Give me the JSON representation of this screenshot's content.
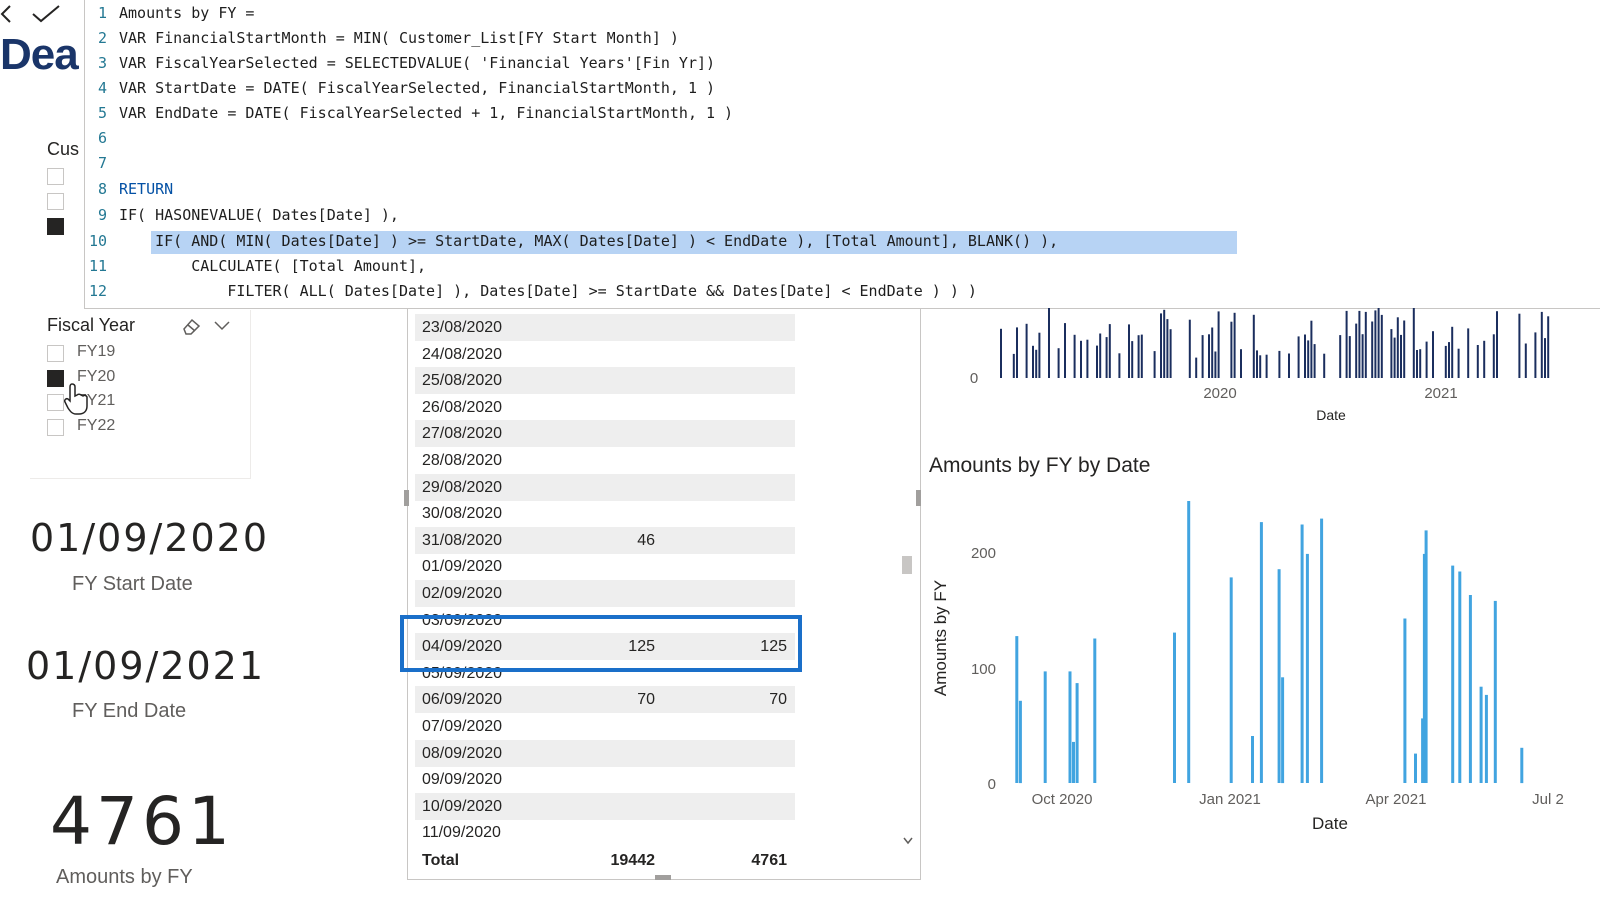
{
  "formula": {
    "lines": [
      {
        "n": "1",
        "text": "Amounts by FY ="
      },
      {
        "n": "2",
        "text": "VAR FinancialStartMonth = MIN( Customer_List[FY Start Month] )"
      },
      {
        "n": "3",
        "text": "VAR FiscalYearSelected = SELECTEDVALUE( 'Financial Years'[Fin Yr])"
      },
      {
        "n": "4",
        "text": "VAR StartDate = DATE( FiscalYearSelected, FinancialStartMonth, 1 )"
      },
      {
        "n": "5",
        "text": "VAR EndDate = DATE( FiscalYearSelected + 1, FinancialStartMonth, 1 )"
      },
      {
        "n": "6",
        "text": ""
      },
      {
        "n": "7",
        "text": ""
      },
      {
        "n": "8",
        "text": "RETURN"
      },
      {
        "n": "9",
        "text": "IF( HASONEVALUE( Dates[Date] ),"
      },
      {
        "n": "10",
        "text": "    IF( AND( MIN( Dates[Date] ) >= StartDate, MAX( Dates[Date] ) < EndDate ), [Total Amount], BLANK() ),"
      },
      {
        "n": "11",
        "text": "        CALCULATE( [Total Amount],"
      },
      {
        "n": "12",
        "text": "            FILTER( ALL( Dates[Date] ), Dates[Date] >= StartDate && Dates[Date] < EndDate ) ) )"
      }
    ]
  },
  "report": {
    "title_fragment": "Dea",
    "customer_slicer_title": "Cus"
  },
  "fy_slicer": {
    "title": "Fiscal Year",
    "items": [
      {
        "label": "FY19",
        "checked": false
      },
      {
        "label": "FY20",
        "checked": true
      },
      {
        "label": "FY21",
        "checked": false
      },
      {
        "label": "FY22",
        "checked": false
      }
    ]
  },
  "cards": {
    "start": {
      "value": "01/09/2020",
      "label": "FY Start Date"
    },
    "end": {
      "value": "01/09/2021",
      "label": "FY End Date"
    },
    "amount": {
      "value": "4761",
      "label": "Amounts by FY"
    }
  },
  "table": {
    "rows": [
      {
        "date": "23/08/2020",
        "a1": "",
        "a2": ""
      },
      {
        "date": "24/08/2020",
        "a1": "",
        "a2": ""
      },
      {
        "date": "25/08/2020",
        "a1": "",
        "a2": ""
      },
      {
        "date": "26/08/2020",
        "a1": "",
        "a2": ""
      },
      {
        "date": "27/08/2020",
        "a1": "",
        "a2": ""
      },
      {
        "date": "28/08/2020",
        "a1": "",
        "a2": ""
      },
      {
        "date": "29/08/2020",
        "a1": "",
        "a2": ""
      },
      {
        "date": "30/08/2020",
        "a1": "",
        "a2": ""
      },
      {
        "date": "31/08/2020",
        "a1": "46",
        "a2": ""
      },
      {
        "date": "01/09/2020",
        "a1": "",
        "a2": ""
      },
      {
        "date": "02/09/2020",
        "a1": "",
        "a2": ""
      },
      {
        "date": "03/09/2020",
        "a1": "",
        "a2": ""
      },
      {
        "date": "04/09/2020",
        "a1": "125",
        "a2": "125"
      },
      {
        "date": "05/09/2020",
        "a1": "",
        "a2": ""
      },
      {
        "date": "06/09/2020",
        "a1": "70",
        "a2": "70"
      },
      {
        "date": "07/09/2020",
        "a1": "",
        "a2": ""
      },
      {
        "date": "08/09/2020",
        "a1": "",
        "a2": ""
      },
      {
        "date": "09/09/2020",
        "a1": "",
        "a2": ""
      },
      {
        "date": "10/09/2020",
        "a1": "",
        "a2": ""
      },
      {
        "date": "11/09/2020",
        "a1": "",
        "a2": ""
      }
    ],
    "total": {
      "label": "Total",
      "a1": "19442",
      "a2": "4761"
    }
  },
  "chart_data": [
    {
      "type": "bar",
      "title": "",
      "xlabel": "Date",
      "ylabel": "",
      "x_ticks": [
        "2020",
        "2021"
      ],
      "y_ticks": [
        "0"
      ],
      "note": "dense daily bars, partially visible (top cropped)"
    },
    {
      "type": "bar",
      "title": "Amounts by FY by Date",
      "xlabel": "Date",
      "ylabel": "Amounts by FY",
      "ylim": [
        0,
        250
      ],
      "y_ticks": [
        "0",
        "100",
        "200"
      ],
      "x_ticks": [
        "Oct 2020",
        "Jan 2021",
        "Apr 2021",
        "Jul 2"
      ],
      "x": [
        "2020-09-04",
        "2020-09-06",
        "2020-09-20",
        "2020-10-04",
        "2020-10-06",
        "2020-10-08",
        "2020-10-18",
        "2020-12-02",
        "2020-12-10",
        "2021-01-03",
        "2021-01-15",
        "2021-01-20",
        "2021-01-30",
        "2021-02-01",
        "2021-02-12",
        "2021-02-15",
        "2021-02-23",
        "2021-04-11",
        "2021-04-17",
        "2021-04-21",
        "2021-04-22",
        "2021-04-23",
        "2021-05-08",
        "2021-05-12",
        "2021-05-18",
        "2021-05-24",
        "2021-05-27",
        "2021-06-01",
        "2021-06-16"
      ],
      "values": [
        125,
        70,
        95,
        95,
        35,
        85,
        123,
        128,
        240,
        175,
        40,
        222,
        182,
        90,
        220,
        195,
        225,
        140,
        25,
        55,
        195,
        215,
        185,
        180,
        160,
        82,
        75,
        155,
        30
      ],
      "color": "#41a4e0"
    }
  ],
  "colors": {
    "highlight_box": "#1a6fc9",
    "bar_dark": "#1b2e5e",
    "bar_light": "#41a4e0",
    "selection": "#b7d3f4"
  }
}
